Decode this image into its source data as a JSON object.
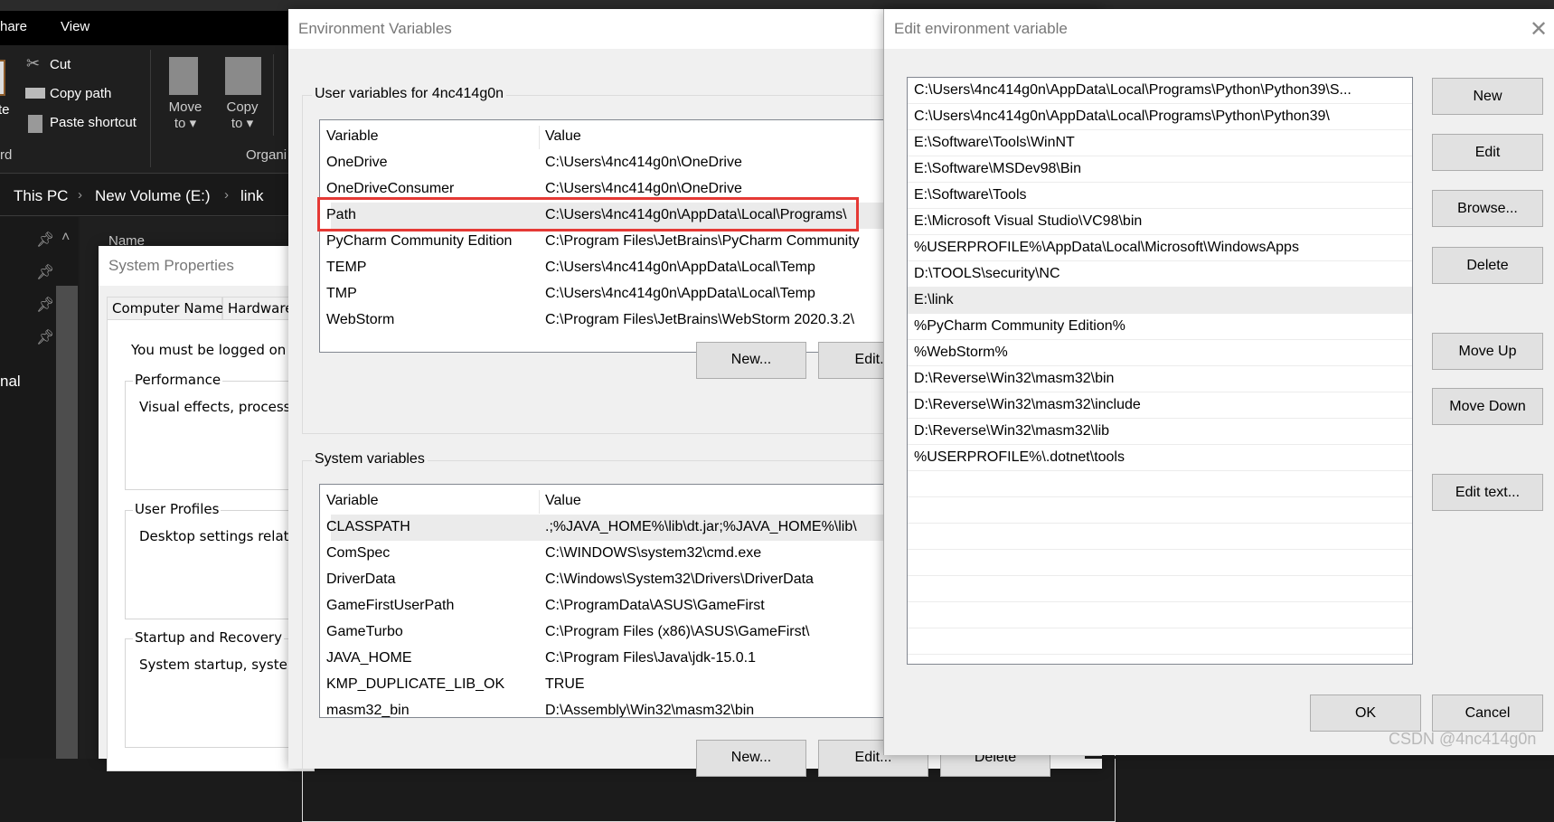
{
  "explorer": {
    "menu": [
      "hare",
      "View"
    ],
    "clipboard": {
      "cut": "Cut",
      "copy_path": "Copy path",
      "paste_shortcut": "Paste shortcut",
      "paste_partial": "te",
      "group_partial": "rd"
    },
    "organize": {
      "move_to": [
        "Move",
        "to"
      ],
      "copy_to": [
        "Copy",
        "to"
      ],
      "group_partial": "Organi"
    },
    "breadcrumb": [
      "This PC",
      "New Volume (E:)",
      "link"
    ],
    "column_name": "Name",
    "nav_partial": "nal"
  },
  "system_properties": {
    "title": "System Properties",
    "tabs": [
      "Computer Name",
      "Hardware"
    ],
    "notice": "You must be logged on a",
    "groups": [
      {
        "label": "Performance",
        "text": "Visual effects, processo"
      },
      {
        "label": "User Profiles",
        "text": "Desktop settings relate"
      },
      {
        "label": "Startup and Recovery",
        "text": "System startup, system"
      }
    ]
  },
  "env_vars": {
    "title": "Environment Variables",
    "user_group": "User variables for 4nc414g0n",
    "headers": {
      "variable": "Variable",
      "value": "Value"
    },
    "user_rows": [
      {
        "name": "OneDrive",
        "value": "C:\\Users\\4nc414g0n\\OneDrive"
      },
      {
        "name": "OneDriveConsumer",
        "value": "C:\\Users\\4nc414g0n\\OneDrive"
      },
      {
        "name": "Path",
        "value": "C:\\Users\\4nc414g0n\\AppData\\Local\\Programs\\"
      },
      {
        "name": "PyCharm Community Edition",
        "value": "C:\\Program Files\\JetBrains\\PyCharm Community"
      },
      {
        "name": "TEMP",
        "value": "C:\\Users\\4nc414g0n\\AppData\\Local\\Temp"
      },
      {
        "name": "TMP",
        "value": "C:\\Users\\4nc414g0n\\AppData\\Local\\Temp"
      },
      {
        "name": "WebStorm",
        "value": "C:\\Program Files\\JetBrains\\WebStorm 2020.3.2\\"
      }
    ],
    "user_buttons": {
      "new": "New...",
      "edit": "Edit..."
    },
    "system_group": "System variables",
    "system_rows": [
      {
        "name": "CLASSPATH",
        "value": ".;%JAVA_HOME%\\lib\\dt.jar;%JAVA_HOME%\\lib\\"
      },
      {
        "name": "ComSpec",
        "value": "C:\\WINDOWS\\system32\\cmd.exe"
      },
      {
        "name": "DriverData",
        "value": "C:\\Windows\\System32\\Drivers\\DriverData"
      },
      {
        "name": "GameFirstUserPath",
        "value": "C:\\ProgramData\\ASUS\\GameFirst"
      },
      {
        "name": "GameTurbo",
        "value": "C:\\Program Files (x86)\\ASUS\\GameFirst\\"
      },
      {
        "name": "JAVA_HOME",
        "value": "C:\\Program Files\\Java\\jdk-15.0.1"
      },
      {
        "name": "KMP_DUPLICATE_LIB_OK",
        "value": "TRUE"
      },
      {
        "name": "masm32_bin",
        "value": "D:\\Assembly\\Win32\\masm32\\bin"
      }
    ],
    "system_buttons": {
      "new": "New...",
      "edit": "Edit...",
      "delete": "Delete"
    },
    "highlight_color": "#e53935"
  },
  "edit_env": {
    "title": "Edit environment variable",
    "entries": [
      "C:\\Users\\4nc414g0n\\AppData\\Local\\Programs\\Python\\Python39\\S...",
      "C:\\Users\\4nc414g0n\\AppData\\Local\\Programs\\Python\\Python39\\",
      "E:\\Software\\Tools\\WinNT",
      "E:\\Software\\MSDev98\\Bin",
      "E:\\Software\\Tools",
      "E:\\Microsoft Visual Studio\\VC98\\bin",
      "%USERPROFILE%\\AppData\\Local\\Microsoft\\WindowsApps",
      "D:\\TOOLS\\security\\NC",
      "E:\\link",
      "%PyCharm Community Edition%",
      "%WebStorm%",
      "D:\\Reverse\\Win32\\masm32\\bin",
      "D:\\Reverse\\Win32\\masm32\\include",
      "D:\\Reverse\\Win32\\masm32\\lib",
      "%USERPROFILE%\\.dotnet\\tools"
    ],
    "selected_index": 8,
    "buttons": {
      "new": "New",
      "edit": "Edit",
      "browse": "Browse...",
      "delete": "Delete",
      "move_up": "Move Up",
      "move_down": "Move Down",
      "edit_text": "Edit text..."
    },
    "ok": "OK",
    "cancel": "Cancel"
  },
  "watermark": "CSDN @4nc414g0n"
}
